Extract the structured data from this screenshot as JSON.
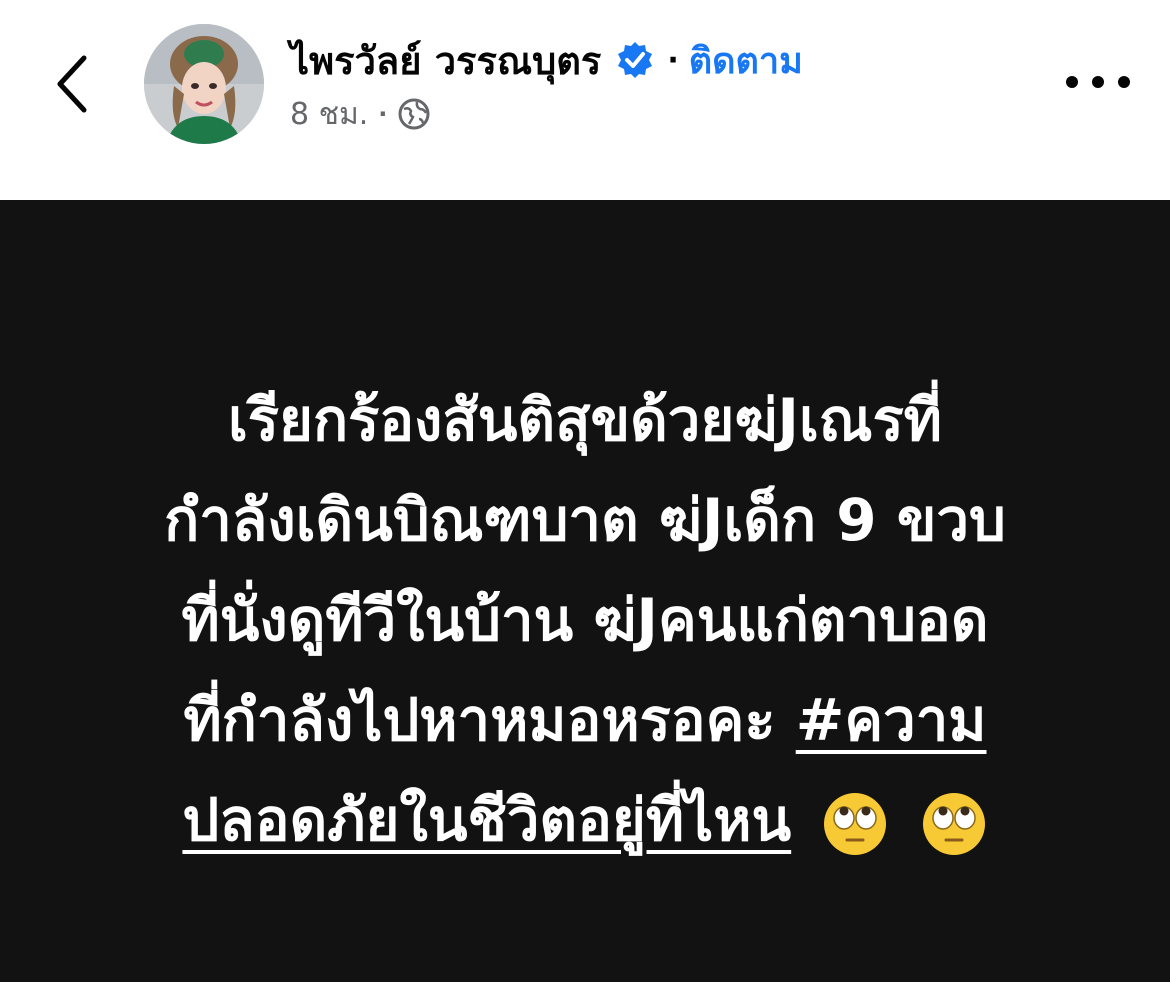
{
  "header": {
    "author_name": "ไพรวัลย์ วรรณบุตร",
    "separator": "·",
    "follow_label": "ติดตาม",
    "timestamp": "8 ชม.",
    "meta_separator": "·",
    "privacy_icon": "globe-icon",
    "back_icon": "chevron-left-icon",
    "more_icon": "more-horizontal-icon",
    "verified_icon": "verified-badge-icon"
  },
  "post": {
    "lines": [
      "เรียกร้องสันติสุขด้วยฆ่Jเณรที่",
      "กำลังเดินบิณฑบาต ฆ่Jเด็ก 9 ขวบ",
      "ที่นั่งดูทีวีในบ้าน ฆ่Jคนแก่ตาบอด",
      "ที่กำลังไปหาหมอหรอคะ "
    ],
    "hashtag_part1": "#ความ",
    "hashtag_part2": "ปลอดภัยในชีวิตอยู่ที่ไหน",
    "emoji": [
      "eye-roll-emoji",
      "eye-roll-emoji"
    ]
  },
  "colors": {
    "post_background": "#121212",
    "follow_blue": "#1877f2",
    "verified_blue": "#1877f2"
  }
}
